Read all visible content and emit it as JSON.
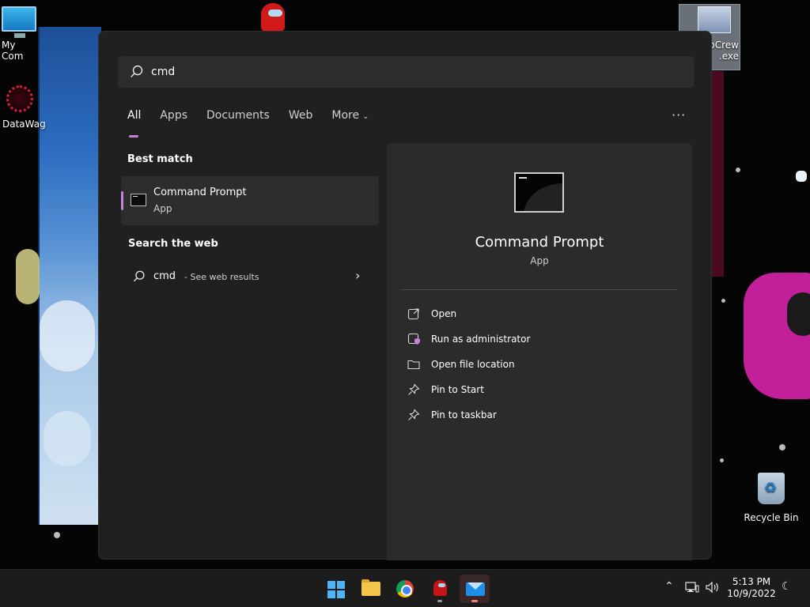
{
  "desktop": {
    "icons": [
      {
        "id": "my-computer",
        "label": "My Com"
      },
      {
        "id": "datawag",
        "label": "DataWag"
      },
      {
        "id": "crew-exe",
        "label_line1": "pCrew",
        "label_line2": ".exe"
      },
      {
        "id": "recycle-bin",
        "label": "Recycle Bin"
      }
    ]
  },
  "search": {
    "query": "cmd",
    "tabs": [
      {
        "label": "All",
        "active": true
      },
      {
        "label": "Apps"
      },
      {
        "label": "Documents"
      },
      {
        "label": "Web"
      },
      {
        "label": "More"
      }
    ],
    "more_options": "···",
    "best_match": {
      "heading": "Best match",
      "name": "Command Prompt",
      "type": "App"
    },
    "web": {
      "heading": "Search the web",
      "query": "cmd",
      "hint": "- See web results"
    },
    "detail": {
      "name": "Command Prompt",
      "type": "App",
      "actions": [
        {
          "label": "Open",
          "icon": "open-external-icon"
        },
        {
          "label": "Run as administrator",
          "icon": "shield-window-icon"
        },
        {
          "label": "Open file location",
          "icon": "folder-icon"
        },
        {
          "label": "Pin to Start",
          "icon": "pin-icon"
        },
        {
          "label": "Pin to taskbar",
          "icon": "pin-icon"
        }
      ]
    }
  },
  "taskbar": {
    "apps": [
      "start-icon",
      "file-explorer-icon",
      "chrome-icon",
      "among-us-icon",
      "mail-icon"
    ],
    "clock": {
      "time": "5:13 PM",
      "date": "10/9/2022"
    }
  },
  "colors": {
    "panel_bg": "#202020",
    "detail_bg": "#2b2b2b",
    "accent": "#c585d6",
    "taskbar_bg": "#1c1c1c"
  }
}
